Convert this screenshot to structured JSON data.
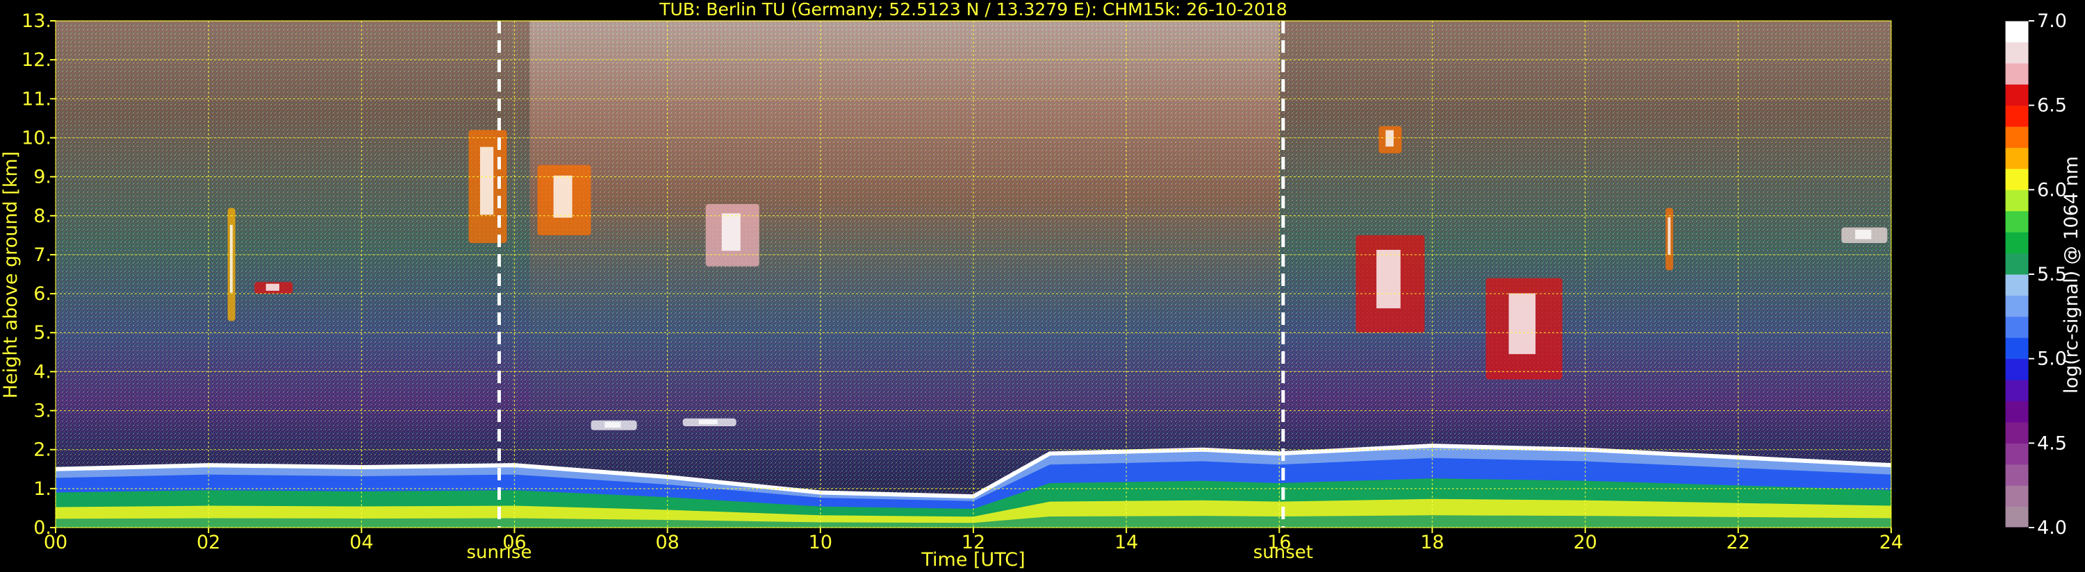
{
  "chart_data": {
    "type": "heatmap",
    "title": "TUB: Berlin TU (Germany; 52.5123 N / 13.3279 E):    CHM15k: 26-10-2018",
    "xlabel": "Time [UTC]",
    "ylabel": "Height above ground [km]",
    "xlim": [
      0,
      24
    ],
    "ylim": [
      0,
      13
    ],
    "x_ticks": [
      0,
      2,
      4,
      6,
      8,
      10,
      12,
      14,
      16,
      18,
      20,
      22,
      24
    ],
    "x_tick_labels": [
      "00",
      "02",
      "04",
      "06",
      "08",
      "10",
      "12",
      "14",
      "16",
      "18",
      "20",
      "22",
      "24"
    ],
    "y_ticks": [
      0,
      1,
      2,
      3,
      4,
      5,
      6,
      7,
      8,
      9,
      10,
      11,
      12,
      13
    ],
    "y_tick_labels": [
      "0.",
      "1.",
      "2.",
      "3.",
      "4.",
      "5.",
      "6.",
      "7.",
      "8.",
      "9.",
      "10.",
      "11.",
      "12.",
      "13."
    ],
    "grid": true,
    "events": [
      {
        "label": "sunrise",
        "time": 5.8
      },
      {
        "label": "sunset",
        "time": 16.05
      }
    ],
    "colorbar": {
      "label": "log(rc-signal) @ 1064 nm",
      "range": [
        4.0,
        7.0
      ],
      "ticks": [
        4.0,
        4.5,
        5.0,
        5.5,
        6.0,
        6.5,
        7.0
      ],
      "tick_labels": [
        "4.0",
        "4.5",
        "5.0",
        "5.5",
        "6.0",
        "6.5",
        "7.0"
      ],
      "levels": [
        {
          "v": 4.0,
          "color": "#a88ca0"
        },
        {
          "v": 4.125,
          "color": "#a87aa0"
        },
        {
          "v": 4.25,
          "color": "#9c5a9c"
        },
        {
          "v": 4.375,
          "color": "#8e3a96"
        },
        {
          "v": 4.5,
          "color": "#7e1c8c"
        },
        {
          "v": 4.625,
          "color": "#6a0a90"
        },
        {
          "v": 4.75,
          "color": "#5410b4"
        },
        {
          "v": 4.875,
          "color": "#2222e0"
        },
        {
          "v": 5.0,
          "color": "#1a50f0"
        },
        {
          "v": 5.125,
          "color": "#4a7cf4"
        },
        {
          "v": 5.25,
          "color": "#78a4f4"
        },
        {
          "v": 5.375,
          "color": "#9cc4f0"
        },
        {
          "v": 5.5,
          "color": "#20a060"
        },
        {
          "v": 5.625,
          "color": "#10b040"
        },
        {
          "v": 5.75,
          "color": "#40d040"
        },
        {
          "v": 5.875,
          "color": "#b0f030"
        },
        {
          "v": 6.0,
          "color": "#f8f820"
        },
        {
          "v": 6.125,
          "color": "#ffb000"
        },
        {
          "v": 6.25,
          "color": "#ff7000"
        },
        {
          "v": 6.375,
          "color": "#ff2000"
        },
        {
          "v": 6.5,
          "color": "#e01010"
        },
        {
          "v": 6.625,
          "color": "#f0b0b8"
        },
        {
          "v": 6.75,
          "color": "#f0dcdc"
        },
        {
          "v": 6.875,
          "color": "#ffffff"
        }
      ]
    },
    "features": {
      "boundary_layer_top_km": [
        {
          "t": 0,
          "h": 1.5
        },
        {
          "t": 2,
          "h": 1.6
        },
        {
          "t": 4,
          "h": 1.55
        },
        {
          "t": 6,
          "h": 1.6
        },
        {
          "t": 8,
          "h": 1.3
        },
        {
          "t": 10,
          "h": 0.9
        },
        {
          "t": 12,
          "h": 0.8
        },
        {
          "t": 13,
          "h": 1.9
        },
        {
          "t": 15,
          "h": 2.0
        },
        {
          "t": 16,
          "h": 1.9
        },
        {
          "t": 18,
          "h": 2.1
        },
        {
          "t": 20,
          "h": 2.0
        },
        {
          "t": 22,
          "h": 1.8
        },
        {
          "t": 24,
          "h": 1.6
        }
      ],
      "cloud_patches": [
        {
          "t0": 2.25,
          "t1": 2.35,
          "h0": 5.3,
          "h1": 8.2,
          "level": 6.2
        },
        {
          "t0": 2.6,
          "t1": 3.1,
          "h0": 6.0,
          "h1": 6.3,
          "level": 6.6
        },
        {
          "t0": 5.4,
          "t1": 5.9,
          "h0": 7.3,
          "h1": 10.2,
          "level": 6.3
        },
        {
          "t0": 6.3,
          "t1": 7.0,
          "h0": 7.5,
          "h1": 9.3,
          "level": 6.3
        },
        {
          "t0": 8.5,
          "t1": 9.2,
          "h0": 6.7,
          "h1": 8.3,
          "level": 6.7
        },
        {
          "t0": 7.0,
          "t1": 7.6,
          "h0": 2.5,
          "h1": 2.75,
          "level": 6.9
        },
        {
          "t0": 8.2,
          "t1": 8.9,
          "h0": 2.6,
          "h1": 2.8,
          "level": 6.9
        },
        {
          "t0": 17.0,
          "t1": 17.9,
          "h0": 5.0,
          "h1": 7.5,
          "level": 6.5
        },
        {
          "t0": 17.3,
          "t1": 17.6,
          "h0": 9.6,
          "h1": 10.3,
          "level": 6.3
        },
        {
          "t0": 18.7,
          "t1": 19.7,
          "h0": 3.8,
          "h1": 6.4,
          "level": 6.6
        },
        {
          "t0": 21.05,
          "t1": 21.15,
          "h0": 6.6,
          "h1": 8.2,
          "level": 6.3
        },
        {
          "t0": 23.35,
          "t1": 23.95,
          "h0": 7.3,
          "h1": 7.7,
          "level": 6.8
        }
      ]
    }
  }
}
